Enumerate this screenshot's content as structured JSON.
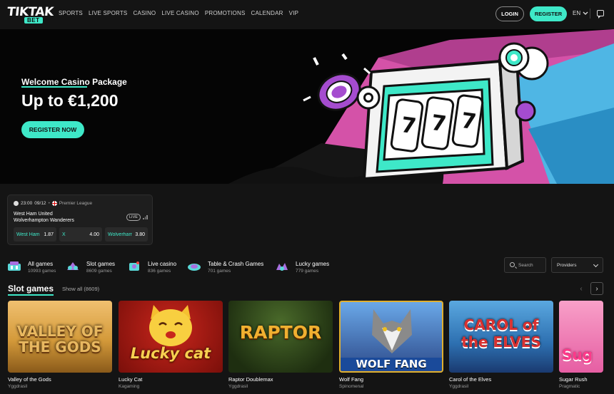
{
  "header": {
    "logo_top": "TIKTAK",
    "logo_bottom": "BET",
    "nav": [
      "SPORTS",
      "LIVE SPORTS",
      "CASINO",
      "LIVE CASINO",
      "PROMOTIONS",
      "CALENDAR",
      "VIP"
    ],
    "login_label": "LOGIN",
    "register_label": "REGISTER",
    "language": "EN"
  },
  "hero": {
    "title": "Welcome Casino Package",
    "amount": "Up to €1,200",
    "cta_label": "REGISTER NOW"
  },
  "match": {
    "time": "23:00",
    "date": "09/12",
    "league": "Premier League",
    "home": "West Ham United",
    "away": "Wolverhampton Wanderers",
    "live_label": "LIVE",
    "odds": [
      {
        "label": "West Ham",
        "value": "1.87"
      },
      {
        "label": "X",
        "value": "4.00"
      },
      {
        "label": "Wolverhampton",
        "value": "3.80"
      }
    ]
  },
  "categories": [
    {
      "name": "All games",
      "count": "10993 games",
      "icon": "all-games-icon"
    },
    {
      "name": "Slot games",
      "count": "8609 games",
      "icon": "slot-games-icon"
    },
    {
      "name": "Live casino",
      "count": "836 games",
      "icon": "live-casino-icon"
    },
    {
      "name": "Table & Crash Games",
      "count": "701 games",
      "icon": "table-crash-icon"
    },
    {
      "name": "Lucky games",
      "count": "779 games",
      "icon": "lucky-games-icon"
    }
  ],
  "filters": {
    "search_placeholder": "Search",
    "providers_label": "Providers"
  },
  "slots": {
    "title": "Slot games",
    "show_all": "Show all (8609)",
    "prev": "‹",
    "next": "›",
    "games": [
      {
        "name": "Valley of the Gods",
        "provider": "Yggdrasil",
        "art": "VALLEY OF THE GODS",
        "bg": "#d49a3a"
      },
      {
        "name": "Lucky Cat",
        "provider": "Kagaming",
        "art": "Lucky cat",
        "bg": "#9b1b14"
      },
      {
        "name": "Raptor Doublemax",
        "provider": "Yggdrasil",
        "art": "RAPTOR",
        "bg": "#2a3a18"
      },
      {
        "name": "Wolf Fang",
        "provider": "Spinomenal",
        "art": "WOLF FANG",
        "bg": "#2d4a8a"
      },
      {
        "name": "Carol of the Elves",
        "provider": "Yggdrasil",
        "art": "CAROL of the ELVES",
        "bg": "#2d6fb0"
      },
      {
        "name": "Sugar Rush",
        "provider": "Pragmatic",
        "art": "Sug",
        "bg": "#e65ea3"
      }
    ]
  }
}
